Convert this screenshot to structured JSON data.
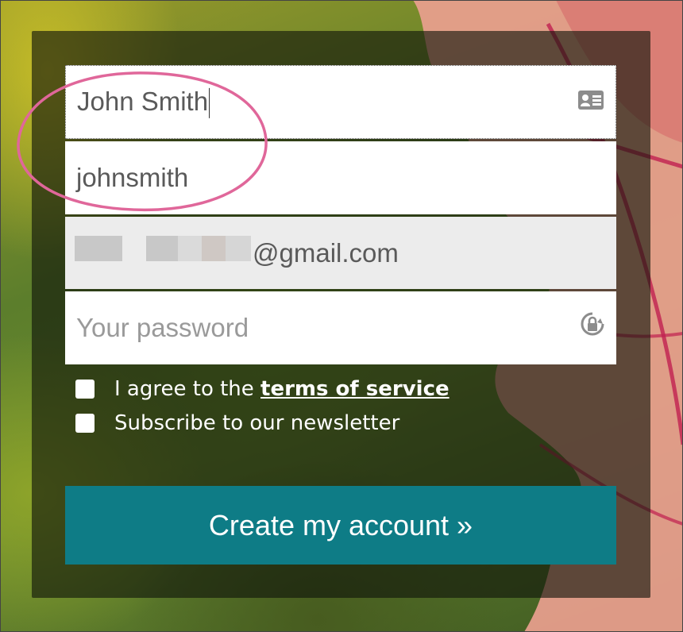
{
  "form": {
    "full_name_value": "John Smith",
    "username_value": "johnsmith",
    "email_suffix": "@gmail.com",
    "password_placeholder": "Your password",
    "terms_prefix": "I agree to the ",
    "terms_link": "terms of service",
    "newsletter_label": "Subscribe to our newsletter",
    "submit_label": "Create my account »"
  },
  "icons": {
    "name_field": "contact-card-icon",
    "password_field": "password-lock-icon"
  },
  "colors": {
    "button": "#0e7c86",
    "highlight": "#e0679a"
  }
}
